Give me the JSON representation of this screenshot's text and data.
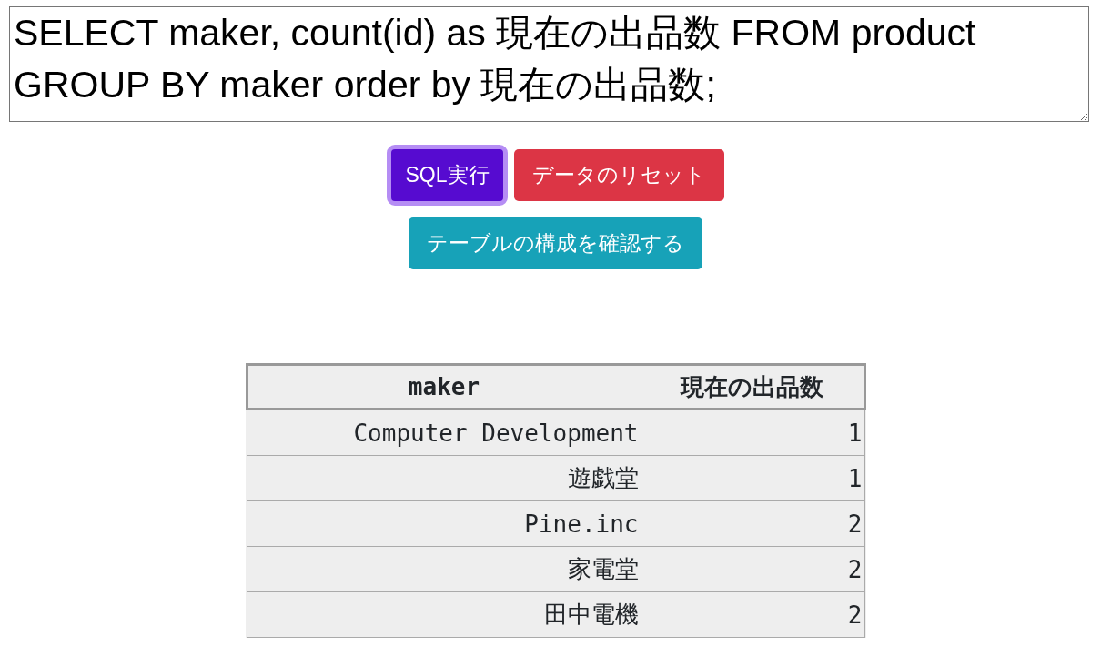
{
  "query": {
    "value": "SELECT maker, count(id) as 現在の出品数 FROM product GROUP BY maker order by 現在の出品数;"
  },
  "button_rows": [
    {
      "buttons": [
        {
          "label": "SQL実行",
          "color": "#560bd0",
          "focused": true
        },
        {
          "label": "データのリセット",
          "color": "#dc3545",
          "focused": false
        }
      ]
    },
    {
      "buttons": [
        {
          "label": "テーブルの構成を確認する",
          "color": "#17a2b8",
          "focused": false
        }
      ]
    }
  ],
  "table": {
    "columns": [
      "maker",
      "現在の出品数"
    ],
    "rows": [
      [
        "Computer Development",
        "1"
      ],
      [
        "遊戯堂",
        "1"
      ],
      [
        "Pine.inc",
        "2"
      ],
      [
        "家電堂",
        "2"
      ],
      [
        "田中電機",
        "2"
      ]
    ]
  }
}
